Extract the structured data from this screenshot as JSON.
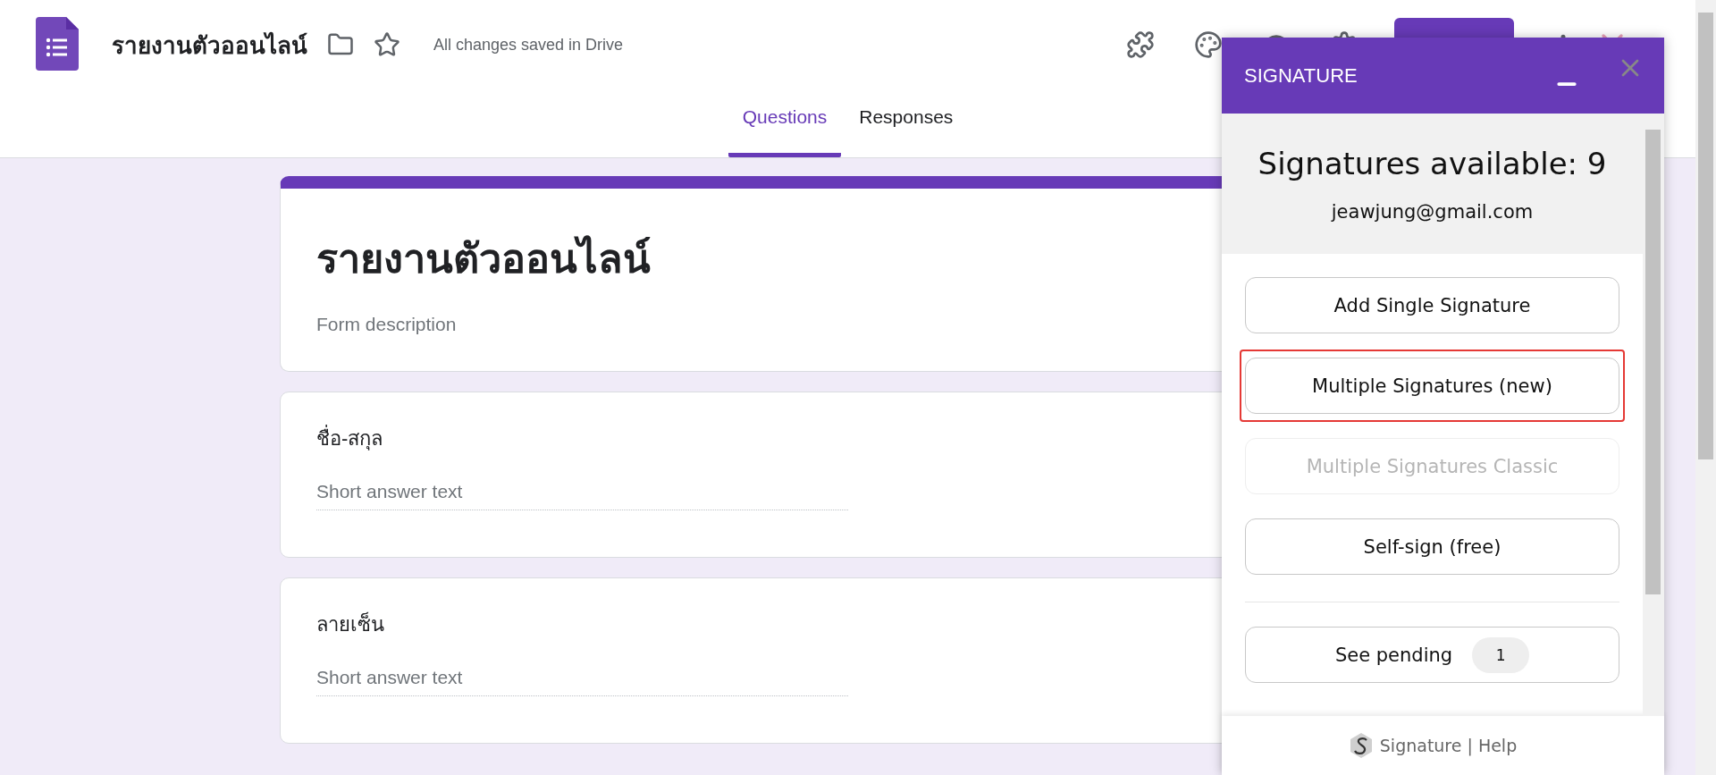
{
  "app": {
    "title": "รายงานตัวออนไลน์",
    "save_status": "All changes saved in Drive"
  },
  "tabs": [
    {
      "label": "Questions",
      "selected": true
    },
    {
      "label": "Responses",
      "selected": false
    }
  ],
  "form": {
    "title": "รายงานตัวออนไลน์",
    "description": "Form description"
  },
  "questions": [
    {
      "title": "ชื่อ-สกุล",
      "placeholder": "Short answer text"
    },
    {
      "title": "ลายเซ็น",
      "placeholder": "Short answer text"
    }
  ],
  "panel": {
    "title": "SIGNATURE",
    "available": "Signatures available: 9",
    "email": "jeawjung@gmail.com",
    "buttons": [
      {
        "label": "Add Single Signature",
        "disabled": false,
        "highlighted": false
      },
      {
        "label": "Multiple Signatures (new)",
        "disabled": false,
        "highlighted": true
      },
      {
        "label": "Multiple Signatures Classic",
        "disabled": true,
        "highlighted": false
      },
      {
        "label": "Self-sign (free)",
        "disabled": false,
        "highlighted": false
      }
    ],
    "pending": {
      "label": "See pending",
      "count": "1"
    },
    "footer": {
      "brand": "Signature",
      "separator": "|",
      "link": "Help"
    }
  }
}
